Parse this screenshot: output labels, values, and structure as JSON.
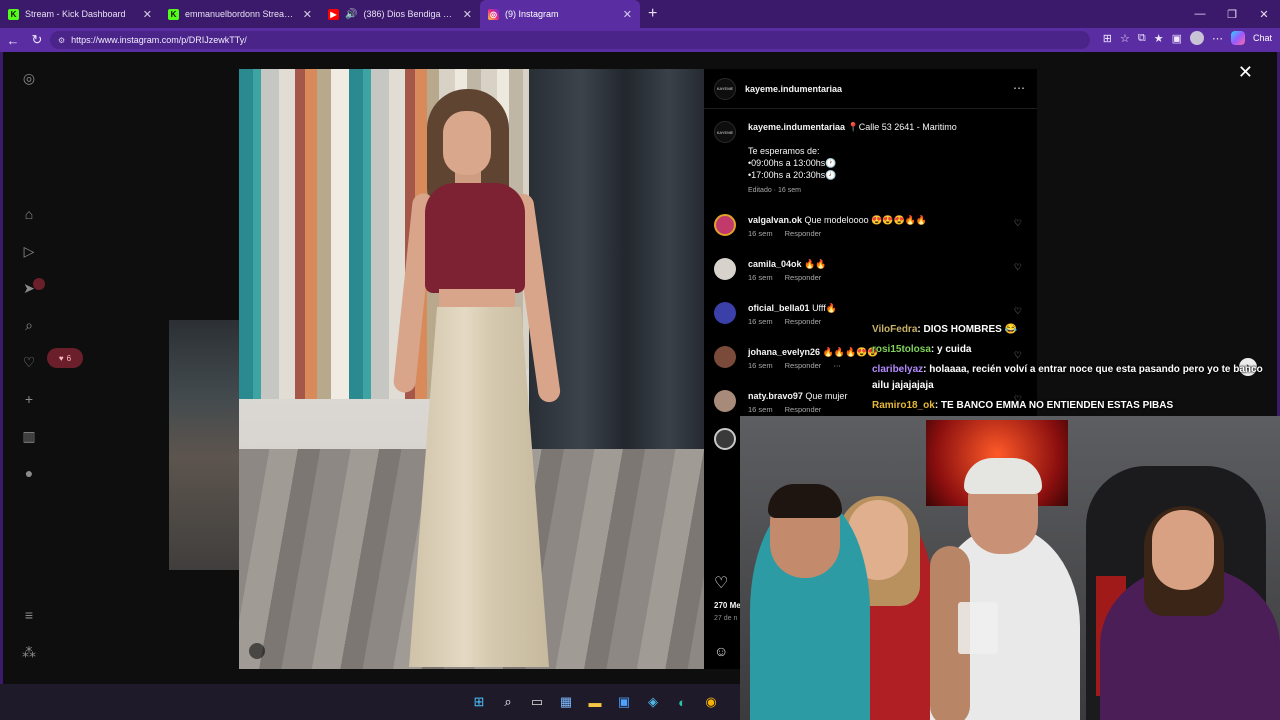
{
  "browser": {
    "tabs": [
      {
        "title": "Stream - Kick Dashboard",
        "favicon": "kick-icon",
        "color": "#53fc18",
        "active": false
      },
      {
        "title": "emmanuelbordonn Stream - Watch",
        "favicon": "kick-icon",
        "color": "#53fc18",
        "active": false
      },
      {
        "title": "(386) Dios Bendiga Remix - A",
        "favicon": "youtube-icon",
        "color": "#ff0000",
        "active": false
      },
      {
        "title": "(9) Instagram",
        "favicon": "instagram-icon",
        "color": "#e1306c",
        "active": true
      }
    ],
    "url": "https://www.instagram.com/p/DRIJzewkTTy/",
    "chat_label": "Chat"
  },
  "instagram": {
    "notifications_count": "6",
    "post": {
      "username": "kayeme.indumentariaa",
      "logo_text": "KAYEME",
      "caption_location": "📍Calle 53 2641 - Maritimo",
      "caption_line1": "Te esperamos de:",
      "caption_line2": "•09:00hs a 13:00hs🕐",
      "caption_line3": "•17:00hs a 20:30hs🕗",
      "edited": "Editado · 16 sem",
      "likes": "270 Me",
      "date": "27 de n"
    },
    "comments": [
      {
        "user": "valgalvan.ok",
        "text": "Que modeloooo 😍😍😍🔥🔥",
        "age": "16 sem",
        "reply": "Responder",
        "color": "#c23a6b"
      },
      {
        "user": "camila_04ok",
        "text": "🔥🔥",
        "age": "16 sem",
        "reply": "Responder",
        "color": "#d7d2cc"
      },
      {
        "user": "oficial_bella01",
        "text": "Ufff🔥",
        "age": "16 sem",
        "reply": "Responder",
        "color": "#3b3fa8"
      },
      {
        "user": "johana_evelyn26",
        "text": "🔥🔥🔥😍😍",
        "age": "16 sem",
        "reply": "Responder",
        "color": "#7a4b3a"
      },
      {
        "user": "naty.bravo97",
        "text": "Que mujer",
        "age": "16 sem",
        "reply": "Responder",
        "color": "#a88a7a"
      }
    ]
  },
  "stream_chat": [
    {
      "user": "ViloFedra",
      "text": ": DIOS HOMBRES 😂"
    },
    {
      "user": "rosi15tolosa",
      "text": ": y cuida"
    },
    {
      "user": "claribelyaz",
      "text": ": holaaaa, recién volví a entrar noce que esta pasando pero yo te banco"
    },
    {
      "user": "",
      "text": "ailu jajajajaja"
    },
    {
      "user": "Ramiro18_ok",
      "text": ": TE BANCO EMMA NO ENTIENDEN ESTAS PIBAS"
    }
  ]
}
